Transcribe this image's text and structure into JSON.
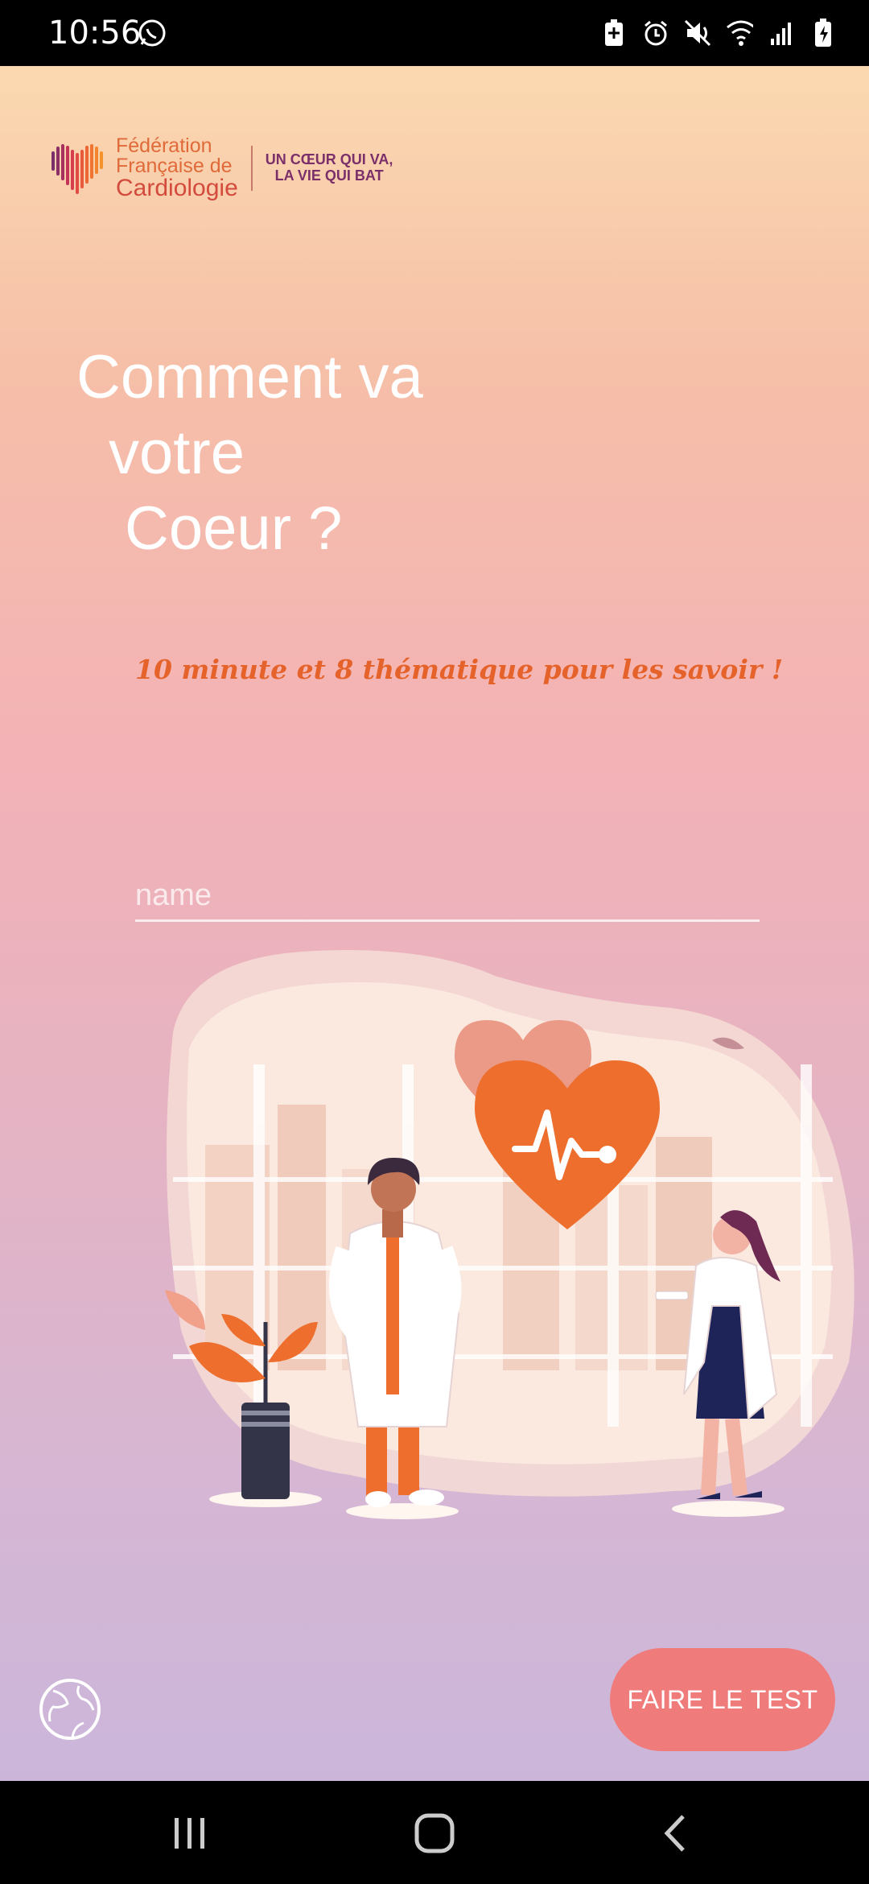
{
  "status_bar": {
    "time": "10:56",
    "icons": [
      "whatsapp-icon",
      "battery-saver-icon",
      "alarm-icon",
      "mute-icon",
      "wifi-icon",
      "signal-icon",
      "battery-charging-icon"
    ]
  },
  "logo": {
    "line1": "Fédération",
    "line2": "Française de",
    "line3": "Cardiologie",
    "tagline1": "UN CŒUR QUI VA,",
    "tagline2": "LA VIE QUI BAT"
  },
  "headline": {
    "line1": "Comment va",
    "line2": "votre",
    "line3": "Coeur ?"
  },
  "subtitle": "10 minute et 8 thématique pour les savoir !",
  "name_input": {
    "placeholder": "name",
    "value": ""
  },
  "illustration": {
    "icon": "doctors-heart-illustration"
  },
  "language_button": {
    "icon": "globe-icon"
  },
  "cta": {
    "label": "FAIRE LE TEST"
  },
  "colors": {
    "accent": "#e5632b",
    "cta": "#f07b7b",
    "heart": "#ee6f2d"
  },
  "nav_bar": {
    "icons": [
      "recents-icon",
      "home-icon",
      "back-icon"
    ]
  }
}
